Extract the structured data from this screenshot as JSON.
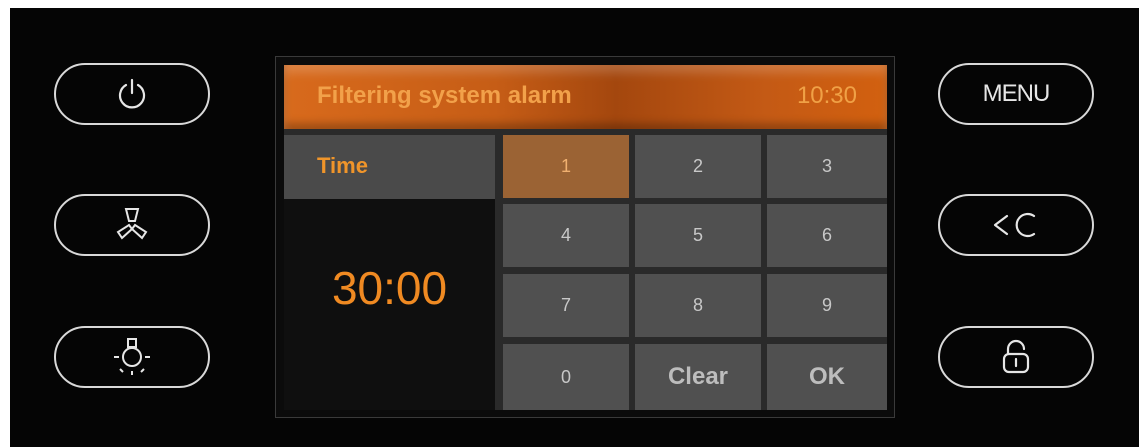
{
  "screen": {
    "title": "Filtering system alarm",
    "clock": "10:30",
    "left_panel": {
      "label": "Time",
      "value": "30:00"
    },
    "keypad": {
      "keys": [
        "1",
        "2",
        "3",
        "4",
        "5",
        "6",
        "7",
        "8",
        "9",
        "0",
        "Clear",
        "OK"
      ],
      "selected_key": "1"
    }
  },
  "hardware_buttons": {
    "right": {
      "menu_label": "MENU"
    }
  },
  "icons": {
    "power": "power-icon",
    "fan": "fan-icon",
    "light": "light-bulb-icon",
    "back": "back-clear-icon",
    "lock": "lock-icon"
  },
  "colors": {
    "panel": "#050505",
    "accent": "#f08a22",
    "titlebar": "#c65d16",
    "key": "#505050",
    "key_active": "#9b6334"
  }
}
